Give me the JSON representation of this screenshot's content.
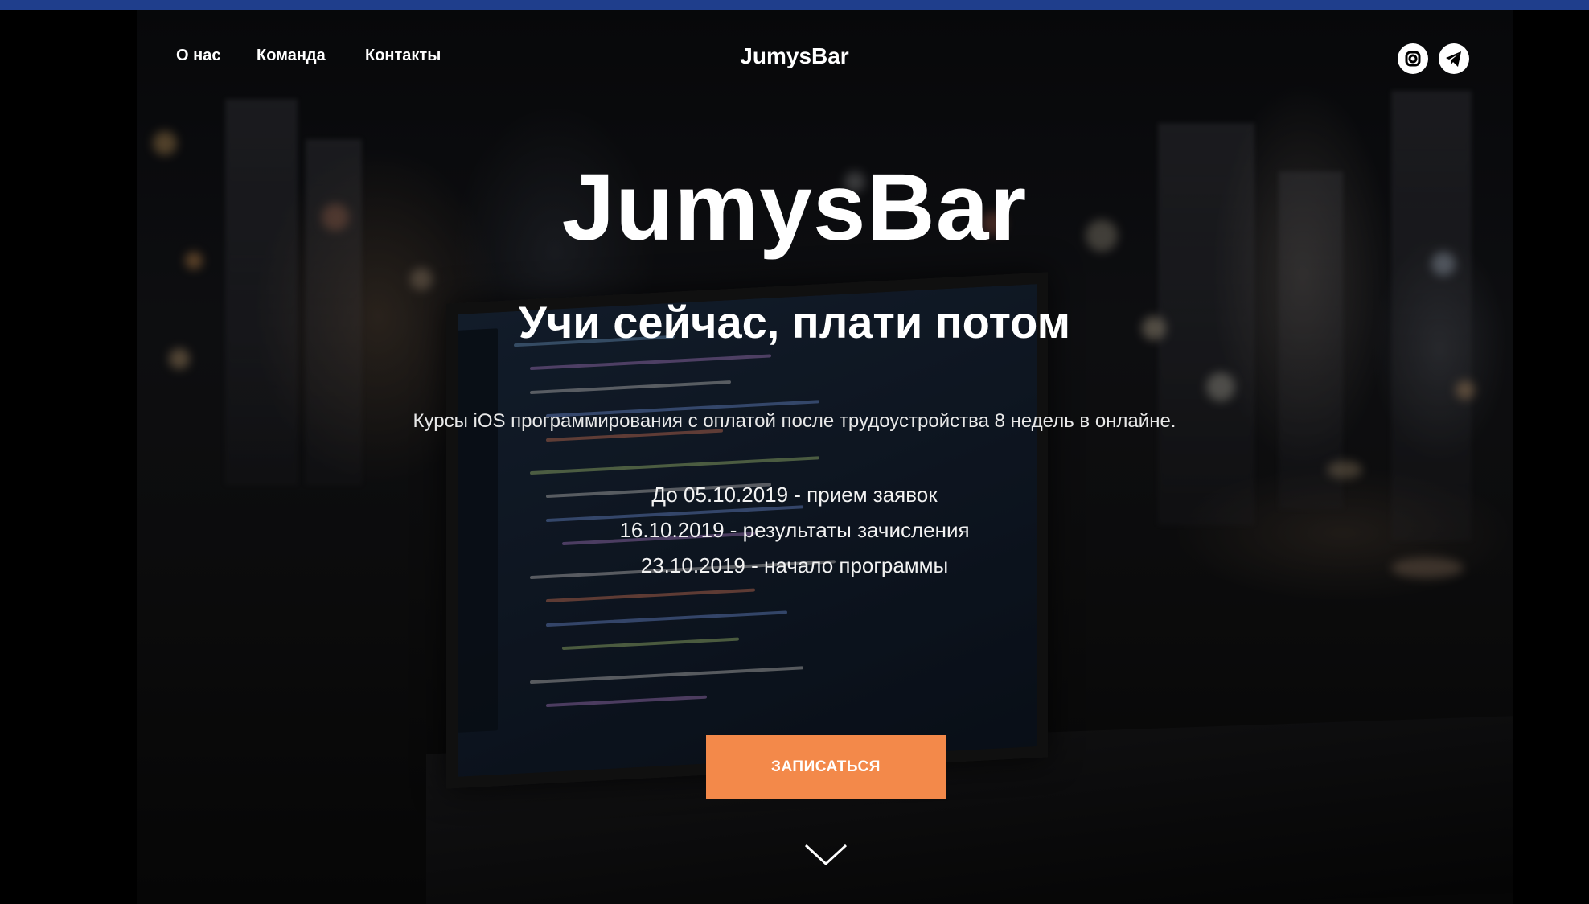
{
  "nav": {
    "links": [
      "О нас",
      "Команда",
      "Контакты"
    ],
    "brand": "JumysBar"
  },
  "social": {
    "icons": [
      "instagram-icon",
      "telegram-icon"
    ]
  },
  "hero": {
    "title": "JumysBar",
    "subtitle": "Учи сейчас, плати потом",
    "description": "Курсы iOS программирования с оплатой после трудоустройства 8 недель в онлайне.",
    "dates": [
      "До 05.10.2019 - прием заявок",
      "16.10.2019 - результаты зачисления",
      "23.10.2019 - начало программы"
    ],
    "cta_label": "ЗАПИСАТЬСЯ",
    "scroll_icon": "chevron-down-icon"
  },
  "colors": {
    "accent": "#f3894a",
    "top_border": "#1f3e8c",
    "text": "#ffffff"
  }
}
